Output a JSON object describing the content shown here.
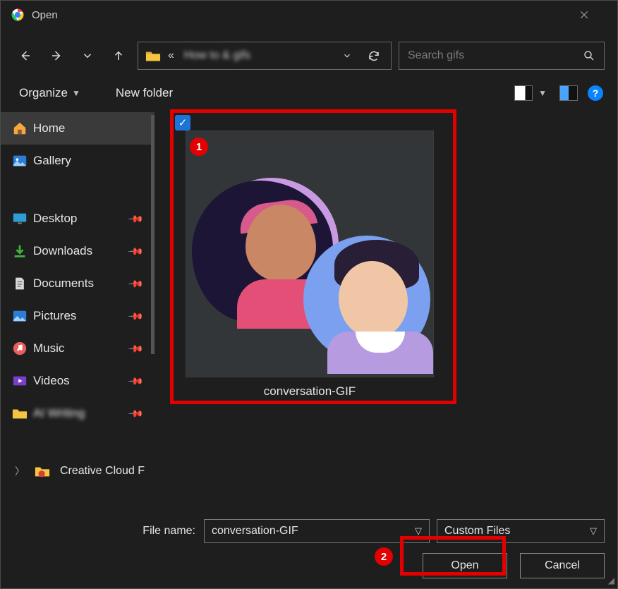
{
  "window": {
    "title": "Open"
  },
  "nav": {
    "address_prefix": "«",
    "address_blurred": "How to  &  gifs",
    "search_placeholder": "Search gifs"
  },
  "toolbar": {
    "organize_label": "Organize",
    "new_folder_label": "New folder",
    "help_label": "?"
  },
  "sidebar": {
    "items": [
      {
        "label": "Home",
        "icon": "home-icon",
        "selected": true,
        "pinned": false
      },
      {
        "label": "Gallery",
        "icon": "gallery-icon",
        "selected": false,
        "pinned": false
      },
      {
        "label": "Desktop",
        "icon": "desktop-icon",
        "selected": false,
        "pinned": true
      },
      {
        "label": "Downloads",
        "icon": "download-icon",
        "selected": false,
        "pinned": true
      },
      {
        "label": "Documents",
        "icon": "document-icon",
        "selected": false,
        "pinned": true
      },
      {
        "label": "Pictures",
        "icon": "picture-icon",
        "selected": false,
        "pinned": true
      },
      {
        "label": "Music",
        "icon": "music-icon",
        "selected": false,
        "pinned": true
      },
      {
        "label": "Videos",
        "icon": "video-icon",
        "selected": false,
        "pinned": true
      },
      {
        "label": "AI Writing",
        "icon": "folder-icon",
        "selected": false,
        "pinned": true,
        "blur": true
      }
    ],
    "expand": {
      "label": "Creative Cloud F"
    }
  },
  "content": {
    "file": {
      "name": "conversation-GIF",
      "selected": true
    }
  },
  "footer": {
    "file_name_label": "File name:",
    "file_name_value": "conversation-GIF",
    "file_type_value": "Custom Files",
    "open_label": "Open",
    "cancel_label": "Cancel"
  },
  "annotations": {
    "badge1": "1",
    "badge2": "2"
  }
}
